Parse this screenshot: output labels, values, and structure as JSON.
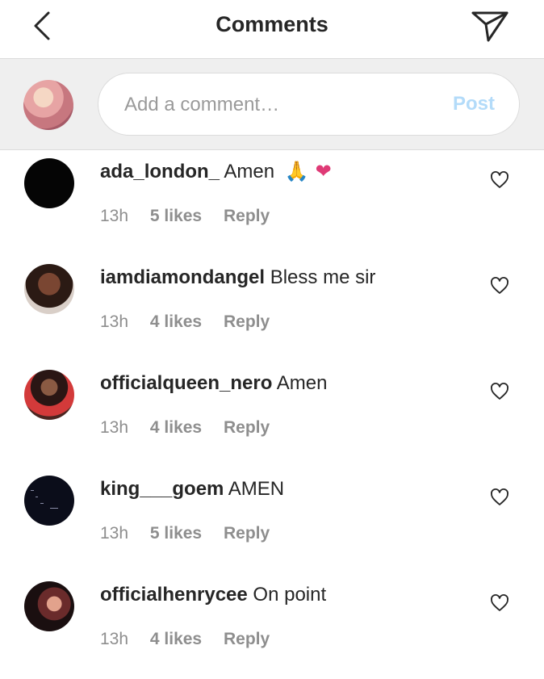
{
  "header": {
    "title": "Comments",
    "back_icon": "chevron-left-icon",
    "share_icon": "paper-plane-icon"
  },
  "composer": {
    "placeholder": "Add a comment…",
    "post_label": "Post",
    "post_color": "#b3dbf9"
  },
  "comments": [
    {
      "username": "ada_london_",
      "text": "Amen",
      "emoji1": "🙏",
      "emoji2": "❤",
      "time": "13h",
      "likes": "5 likes",
      "reply": "Reply"
    },
    {
      "username": "iamdiamondangel",
      "text": "Bless me sir",
      "time": "13h",
      "likes": "4 likes",
      "reply": "Reply"
    },
    {
      "username": "officialqueen_nero",
      "text": "Amen",
      "time": "13h",
      "likes": "4 likes",
      "reply": "Reply"
    },
    {
      "username": "king___goem",
      "text": "AMEN",
      "time": "13h",
      "likes": "5 likes",
      "reply": "Reply"
    },
    {
      "username": "officialhenrycee",
      "text": "On point",
      "time": "13h",
      "likes": "4 likes",
      "reply": "Reply"
    }
  ]
}
